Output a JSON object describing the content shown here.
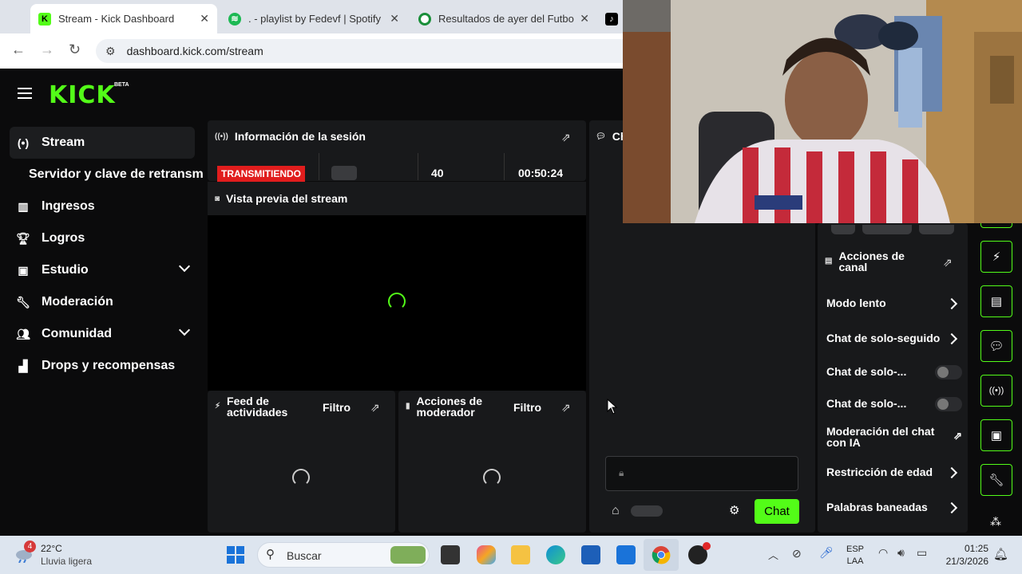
{
  "browser": {
    "tabs": [
      {
        "title": "Stream - Kick Dashboard",
        "active": true
      },
      {
        "title": ". - playlist by Fedevf | Spotify",
        "active": false
      },
      {
        "title": "Resultados de ayer del Futbol A",
        "active": false
      }
    ],
    "url": "dashboard.kick.com/stream"
  },
  "brand": {
    "logo": "KICK",
    "badge": "BETA",
    "accent": "#53fc18"
  },
  "sidebar": {
    "items": [
      {
        "label": "Stream",
        "icon": "stream-icon",
        "active": true
      },
      {
        "label": "Servidor y clave de retransm",
        "icon": "",
        "active": false
      },
      {
        "label": "Ingresos",
        "icon": "chart-icon",
        "active": false
      },
      {
        "label": "Logros",
        "icon": "trophy-icon",
        "active": false
      },
      {
        "label": "Estudio",
        "icon": "studio-icon",
        "active": false,
        "expandable": true
      },
      {
        "label": "Moderación",
        "icon": "wrench-icon",
        "active": false
      },
      {
        "label": "Comunidad",
        "icon": "community-icon",
        "active": false,
        "expandable": true
      },
      {
        "label": "Drops y recompensas",
        "icon": "gift-icon",
        "active": false
      }
    ]
  },
  "session": {
    "title": "Información de la sesión",
    "status": "TRANSMITIENDO",
    "viewers": "40",
    "duration": "00:50:24"
  },
  "preview": {
    "title": "Vista previa del stream"
  },
  "activity": {
    "title": "Feed de actividades",
    "filter": "Filtro"
  },
  "modactions": {
    "title": "Acciones de moderador",
    "filter": "Filtro"
  },
  "chat": {
    "title": "Ch",
    "send_label": "Chat"
  },
  "channel_actions": {
    "title": "Acciones de canal",
    "items": [
      {
        "label": "Modo lento",
        "control": "arrow"
      },
      {
        "label": "Chat de solo-seguido",
        "control": "arrow"
      },
      {
        "label": "Chat de solo-...",
        "control": "toggle"
      },
      {
        "label": "Chat de solo-...",
        "control": "toggle"
      },
      {
        "label": "Moderación del chat con IA",
        "control": "external"
      },
      {
        "label": "Restricción de edad",
        "control": "arrow"
      },
      {
        "label": "Palabras baneadas",
        "control": "arrow"
      }
    ]
  },
  "taskbar": {
    "weather_temp": "22°C",
    "weather_desc": "Lluvia ligera",
    "weather_badge": "4",
    "search_placeholder": "Buscar",
    "lang_line1": "ESP",
    "lang_line2": "LAA",
    "time": "01:25",
    "date": "21/3/2026"
  }
}
